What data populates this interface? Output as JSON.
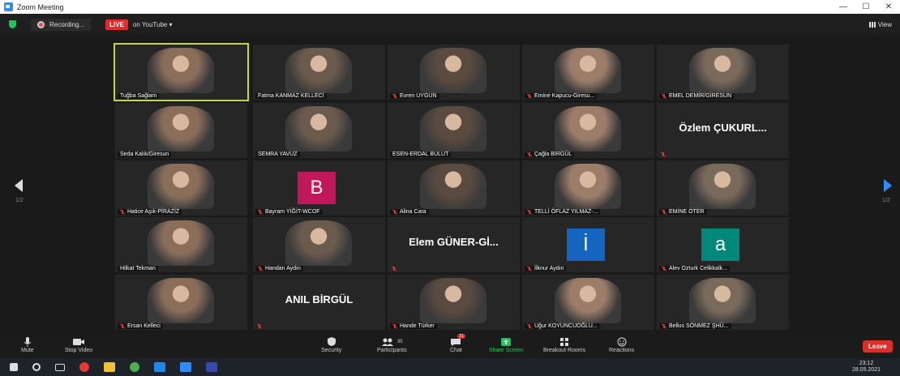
{
  "window": {
    "title": "Zoom Meeting",
    "controls": [
      "—",
      "☐",
      "✕"
    ]
  },
  "topbar": {
    "recording": "Recording...",
    "live": "LIVE",
    "stream": "on YouTube ▾",
    "view": "View"
  },
  "pager": {
    "left": "1/2",
    "right": "1/2"
  },
  "tiles": [
    {
      "name": "Tuğba Sağlam",
      "active": true
    },
    {
      "name": "Fatma KANMAZ KELLECİ"
    },
    {
      "name": "Evren UYGUN",
      "muted": true
    },
    {
      "name": "Emine Kapucu-Giresu...",
      "muted": true
    },
    {
      "name": "EMEL DEMİR/GİRESUN",
      "muted": true
    },
    {
      "name": "Seda Kalık/Giresun"
    },
    {
      "name": "SEMRA YAVUZ"
    },
    {
      "name": "ESEN-ERDAL BULUT"
    },
    {
      "name": "Çağla BİRGÜL",
      "muted": true
    },
    {
      "big": "Özlem ÇUKURL...",
      "muted": true
    },
    {
      "name": "Hatice Aşık-PİRAZİZ",
      "muted": true
    },
    {
      "name": "Bayram YİĞİT-WCOF",
      "muted": true,
      "letter": "B",
      "letter_color": "#c2185b"
    },
    {
      "name": "Alina Cara",
      "muted": true
    },
    {
      "name": "TELLİ ÖFLAZ YILMAZ-...",
      "muted": true
    },
    {
      "name": "EMİNE ÖTER",
      "muted": true
    },
    {
      "name": "Hilkat Tekman"
    },
    {
      "name": "Handan Aydın",
      "muted": true
    },
    {
      "big": "Elem GÜNER-Gİ...",
      "muted": true
    },
    {
      "name": "İlknur Aydın",
      "muted": true,
      "letter": "İ",
      "letter_color": "#1565c0"
    },
    {
      "name": "Alev Ozturk Celikkalk...",
      "muted": true,
      "letter": "a",
      "letter_color": "#00897b"
    },
    {
      "name": "Ersan Kelleci",
      "muted": true
    },
    {
      "big": "ANIL BİRGÜL",
      "muted": true
    },
    {
      "name": "Hande Türker",
      "muted": true
    },
    {
      "name": "Uğur KOYUNCUOĞLU...",
      "muted": true
    },
    {
      "name": "Belkıs SÖNMEZ ŞHÜ...",
      "muted": true
    }
  ],
  "toolbar": {
    "mute": "Mute",
    "stop_video": "Stop Video",
    "security": "Security",
    "participants": "Participants",
    "participants_count": "35",
    "chat": "Chat",
    "chat_badge": "21",
    "share_screen": "Share Screen",
    "breakout": "Breakout Rooms",
    "reactions": "Reactions",
    "leave": "Leave"
  },
  "taskbar": {
    "time": "23:12",
    "date": "28.05.2021"
  },
  "colors": {
    "active_border": "#c8d82c",
    "leave": "#d9302c",
    "share": "#21c45a",
    "live": "#e02c2c"
  }
}
